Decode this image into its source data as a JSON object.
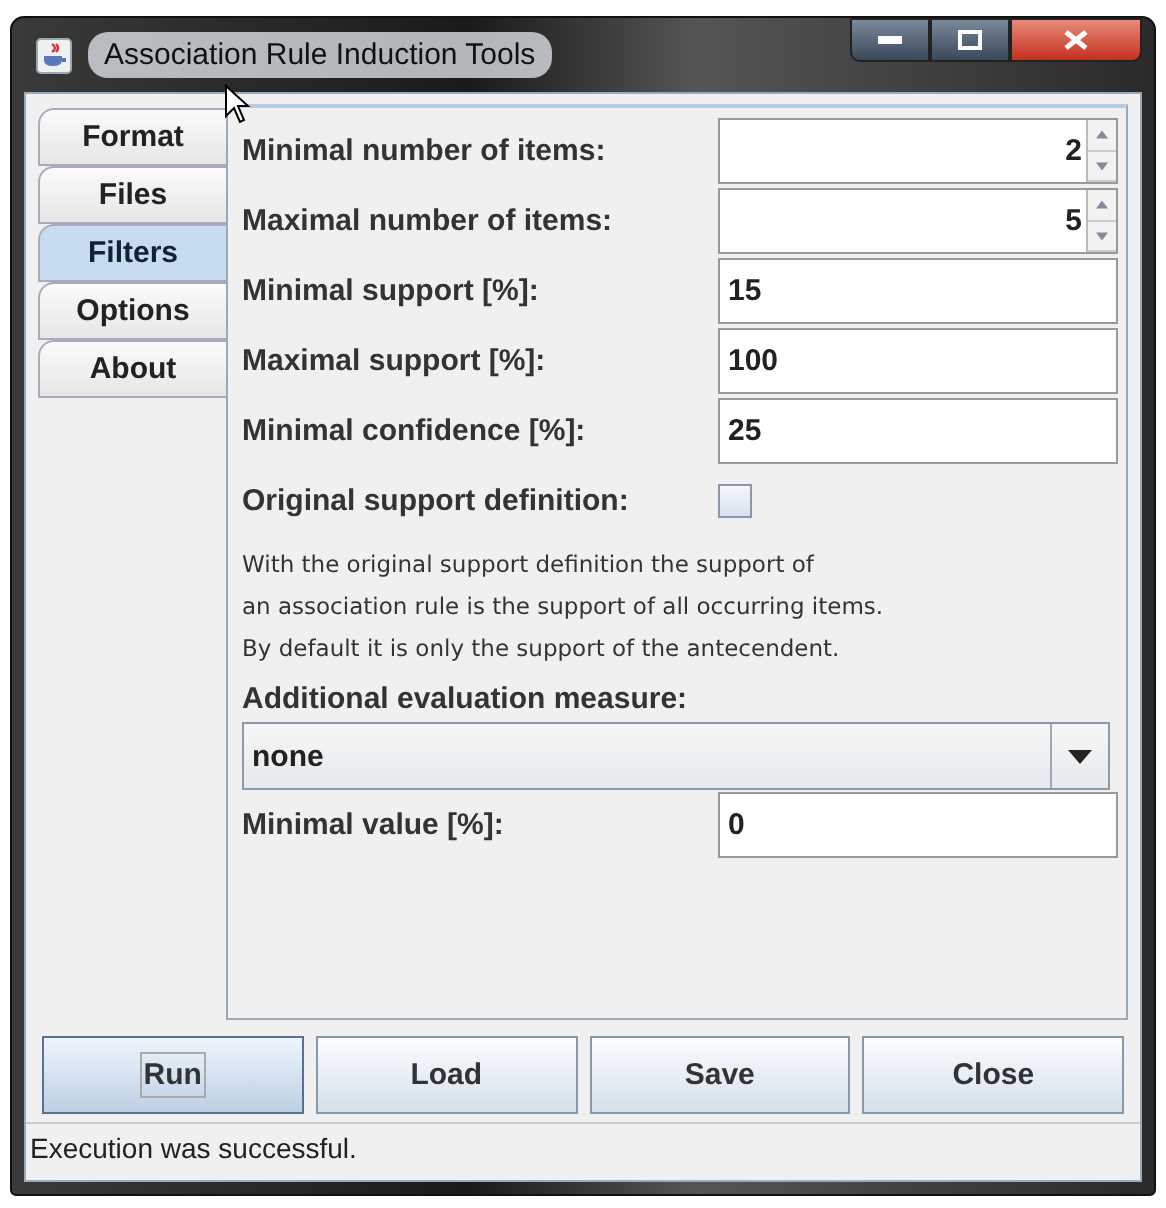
{
  "window": {
    "title": "Association Rule Induction Tools"
  },
  "tabs": [
    {
      "label": "Format",
      "selected": false
    },
    {
      "label": "Files",
      "selected": false
    },
    {
      "label": "Filters",
      "selected": true
    },
    {
      "label": "Options",
      "selected": false
    },
    {
      "label": "About",
      "selected": false
    }
  ],
  "form": [
    {
      "kind": "spinner",
      "label": "Minimal number of items:",
      "value": "2"
    },
    {
      "kind": "spinner",
      "label": "Maximal number of items:",
      "value": "5"
    },
    {
      "kind": "text",
      "label": "Minimal support [%]:",
      "value": "15"
    },
    {
      "kind": "text",
      "label": "Maximal support [%]:",
      "value": "100"
    },
    {
      "kind": "text",
      "label": "Minimal confidence [%]:",
      "value": "25"
    },
    {
      "kind": "checkbox",
      "label": "Original support definition:",
      "checked": false
    },
    {
      "kind": "note",
      "lines": [
        "With the original support definition the support of",
        "an association rule is the support of all occurring items.",
        "By default it is only the support of the antecendent."
      ]
    },
    {
      "kind": "heading",
      "label": "Additional evaluation measure:"
    },
    {
      "kind": "combo",
      "value": "none"
    },
    {
      "kind": "text",
      "label": "Minimal value [%]:",
      "value": "0"
    }
  ],
  "buttons": [
    {
      "label": "Run",
      "focused": true
    },
    {
      "label": "Load",
      "focused": false
    },
    {
      "label": "Save",
      "focused": false
    },
    {
      "label": "Close",
      "focused": false
    }
  ],
  "status_bar": "Execution was successful."
}
